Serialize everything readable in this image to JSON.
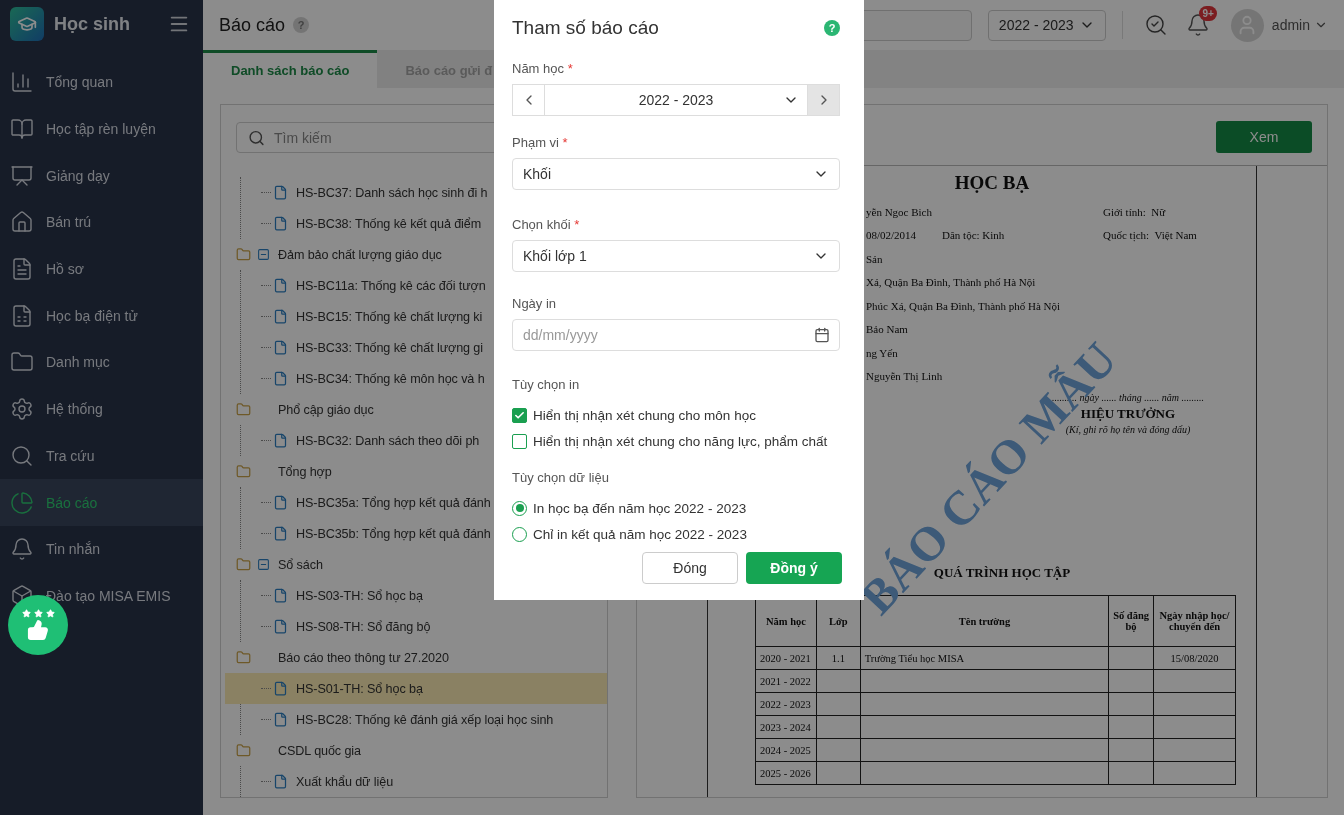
{
  "sidebar": {
    "app_title": "Học sinh",
    "items": [
      {
        "label": "Tổng quan",
        "selected": false
      },
      {
        "label": "Học tập rèn luyện",
        "selected": false
      },
      {
        "label": "Giảng dạy",
        "selected": false
      },
      {
        "label": "Bán trú",
        "selected": false
      },
      {
        "label": "Hồ sơ",
        "selected": false
      },
      {
        "label": "Học bạ điện tử",
        "selected": false
      },
      {
        "label": "Danh mục",
        "selected": false
      },
      {
        "label": "Hệ thống",
        "selected": false
      },
      {
        "label": "Tra cứu",
        "selected": false
      },
      {
        "label": "Báo cáo",
        "selected": true
      },
      {
        "label": "Tin nhắn",
        "selected": false
      },
      {
        "label": "Đào tạo MISA EMIS",
        "selected": false
      }
    ]
  },
  "header": {
    "title": "Báo cáo",
    "help": "?",
    "school_year": "2022 - 2023",
    "notification_badge": "9+",
    "user": "admin"
  },
  "tabs": [
    {
      "label": "Danh sách báo cáo",
      "selected": true
    },
    {
      "label": "Báo cáo gửi đ",
      "selected": false
    }
  ],
  "tree": {
    "search_placeholder": "Tìm kiếm",
    "nodes": [
      {
        "children": [
          {
            "label": "HS-BC37: Danh sách học sinh đi h",
            "selected": false
          },
          {
            "label": "HS-BC38: Thống kê kết quả điểm",
            "selected": false
          }
        ]
      },
      {
        "label": "Đảm bảo chất lượng giáo dục",
        "collapse_button": true,
        "children": [
          {
            "label": "HS-BC11a: Thống kê các đối tượn",
            "selected": false
          },
          {
            "label": "HS-BC15: Thống kê chất lượng ki",
            "selected": false
          },
          {
            "label": "HS-BC33: Thống kê chất lượng gi",
            "selected": false
          },
          {
            "label": "HS-BC34: Thống kê môn học và h",
            "selected": false
          }
        ]
      },
      {
        "label": "Phổ cập giáo dục",
        "collapse_button": false,
        "children": [
          {
            "label": "HS-BC32: Danh sách theo dõi ph",
            "selected": false
          }
        ]
      },
      {
        "label": "Tổng hợp",
        "collapse_button": false,
        "children": [
          {
            "label": "HS-BC35a: Tổng hợp kết quả đánh",
            "selected": false
          },
          {
            "label": "HS-BC35b: Tổng hợp kết quả đánh",
            "selected": false
          }
        ]
      },
      {
        "label": "Sổ sách",
        "collapse_button": true,
        "children": [
          {
            "label": "HS-S03-TH: Sổ học bạ",
            "selected": false
          },
          {
            "label": "HS-S08-TH: Sổ đăng bộ",
            "selected": false
          }
        ]
      },
      {
        "label": "Báo cáo theo thông tư 27.2020",
        "collapse_button": false,
        "children": [
          {
            "label": "HS-S01-TH: Sổ học bạ",
            "selected": true
          },
          {
            "label": "HS-BC28: Thống kê đánh giá xếp loại học sinh",
            "selected": false
          }
        ]
      },
      {
        "label": "CSDL quốc gia",
        "collapse_button": false,
        "children": [
          {
            "label": "Xuất khẩu dữ liệu",
            "selected": false
          }
        ]
      }
    ]
  },
  "preview": {
    "view_button": "Xem",
    "document": {
      "title": "HỌC BẠ",
      "info_rows": [
        {
          "main": "yễn Ngoc Bich",
          "right": "Giới tính:  Nữ"
        },
        {
          "main": "08/02/2014",
          "middle": "Dân tộc:  Kinh",
          "right": "Quốc tịch:  Việt Nam"
        },
        {
          "main": "Sán"
        },
        {
          "main": "Xá, Quận Ba Đình, Thành phố Hà Nội"
        },
        {
          "main": "Phúc Xá, Quận Ba Đình, Thành phố Hà Nội"
        },
        {
          "main": "Bảo Nam"
        },
        {
          "main": "ng Yến"
        },
        {
          "main": "Nguyễn Thị Linh"
        }
      ],
      "stamp": "BÁO CÁO MẪU",
      "signature": {
        "date_line": ".......... ngày ...... tháng ...... năm .........",
        "title": "HIỆU TRƯỞNG",
        "note": "(Kí, ghi rõ họ tên và đóng dấu)"
      },
      "table": {
        "title": "QUÁ TRÌNH HỌC TẬP",
        "columns": [
          "Năm học",
          "Lớp",
          "Tên trường",
          "Số đăng bộ",
          "Ngày nhập học/ chuyển đến"
        ],
        "rows": [
          {
            "year": "2020 - 2021",
            "class": "1.1",
            "school": "Trường Tiểu học MISA",
            "date": "15/08/2020"
          },
          {
            "year": "2021 - 2022"
          },
          {
            "year": "2022 - 2023"
          },
          {
            "year": "2023 - 2024"
          },
          {
            "year": "2024 - 2025"
          },
          {
            "year": "2025 - 2026"
          }
        ]
      }
    }
  },
  "dialog": {
    "title": "Tham số báo cáo",
    "help": "?",
    "school_year": {
      "label": "Năm học",
      "required_mark": "*",
      "value": "2022 - 2023"
    },
    "scope": {
      "label": "Phạm vi",
      "required_mark": "*",
      "value": "Khối"
    },
    "grade": {
      "label": "Chọn khối",
      "required_mark": "*",
      "value": "Khối lớp 1"
    },
    "print_date": {
      "label": "Ngày in",
      "placeholder": "dd/mm/yyyy"
    },
    "print_options": {
      "label": "Tùy chọn in",
      "items": [
        {
          "label": "Hiển thị nhận xét chung cho môn học",
          "checked": true
        },
        {
          "label": "Hiển thị nhận xét chung cho năng lực, phẩm chất",
          "checked": false
        }
      ]
    },
    "data_options": {
      "label": "Tùy chọn dữ liệu",
      "items": [
        {
          "label": "In học bạ đến năm học 2022 - 2023",
          "selected": true
        },
        {
          "label": "Chỉ in kết quả năm học 2022 - 2023",
          "selected": false
        }
      ]
    },
    "buttons": {
      "cancel": "Đóng",
      "ok": "Đồng ý"
    }
  }
}
